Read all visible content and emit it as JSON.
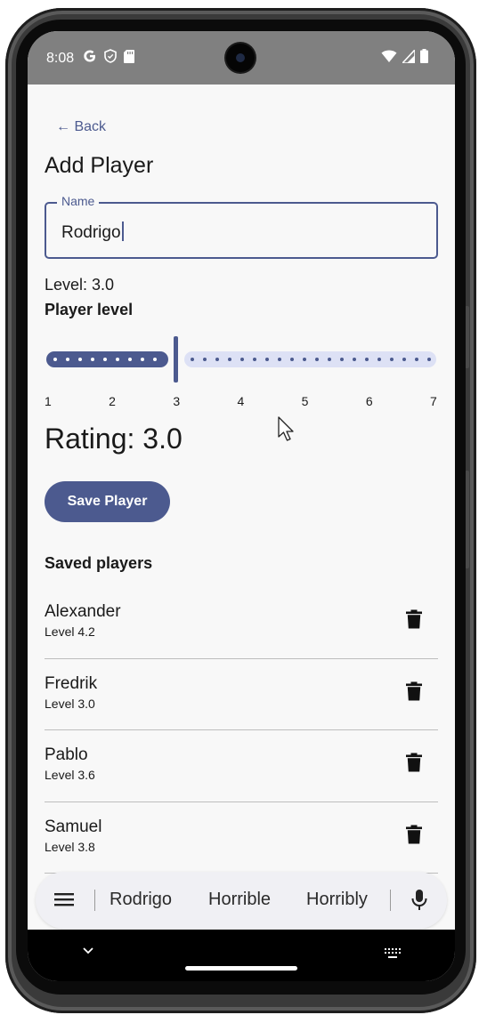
{
  "status_bar": {
    "time": "8:08",
    "left_icons": [
      "google-icon",
      "shield-icon",
      "sd-card-icon"
    ],
    "right_icons": [
      "wifi-icon",
      "signal-icon",
      "battery-icon"
    ]
  },
  "header": {
    "back_label": "← Back",
    "title": "Add Player"
  },
  "name_field": {
    "label": "Name",
    "value": "Rodrigo"
  },
  "level": {
    "text": "Level: 3.0",
    "label": "Player level",
    "value": 3.0,
    "min": 1,
    "max": 7,
    "ticks": [
      "1",
      "2",
      "3",
      "4",
      "5",
      "6",
      "7"
    ]
  },
  "rating_text": "Rating: 3.0",
  "save_button_label": "Save Player",
  "saved_players": {
    "title": "Saved players",
    "players": [
      {
        "name": "Alexander",
        "level": "Level 4.2"
      },
      {
        "name": "Fredrik",
        "level": "Level 3.0"
      },
      {
        "name": "Pablo",
        "level": "Level 3.6"
      },
      {
        "name": "Samuel",
        "level": "Level 3.8"
      }
    ]
  },
  "keyboard": {
    "suggestions": [
      "Rodrigo",
      "Horrible",
      "Horribly"
    ]
  },
  "colors": {
    "accent": "#4c5a8f",
    "accent_light": "#dde1f5",
    "status_bar": "#808080"
  }
}
